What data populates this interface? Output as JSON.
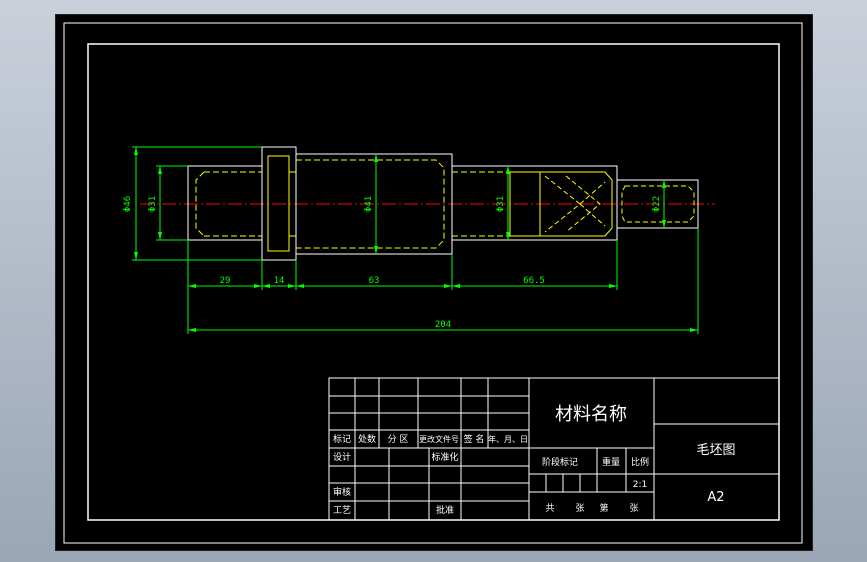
{
  "colors": {
    "background": "#000000",
    "frame": "#ffffff",
    "part_outline": "#ffffff",
    "hidden_line": "#ffff00",
    "dimension": "#00ff00",
    "center_line": "#ff0000"
  },
  "dimensions": {
    "d_left_outer": "Φ46",
    "d_left_inner": "Φ31",
    "d_middle": "Φ41",
    "d_right_step": "Φ31",
    "d_right_end": "Φ22",
    "len_1": "29",
    "len_2": "14",
    "len_3": "63",
    "len_4": "66.5",
    "total_length": "204"
  },
  "title_block": {
    "material_name": "材料名称",
    "drawing_name": "毛坯图",
    "sheet_size": "A2",
    "scale": "2:1",
    "row_headers": {
      "mark": "标记",
      "count": "处数",
      "zone": "分 区",
      "change_doc": "更改文件号",
      "signature": "签 名",
      "date": "年、月、日"
    },
    "design": "设计",
    "standardize": "标准化",
    "review": "审核",
    "process": "工艺",
    "approve": "批准",
    "stage_mark": "阶段标记",
    "weight": "重量",
    "ratio": "比例",
    "sheets_total": "共",
    "sheets_unit": "张",
    "sheet_no": "第",
    "sheet_unit2": "张"
  }
}
